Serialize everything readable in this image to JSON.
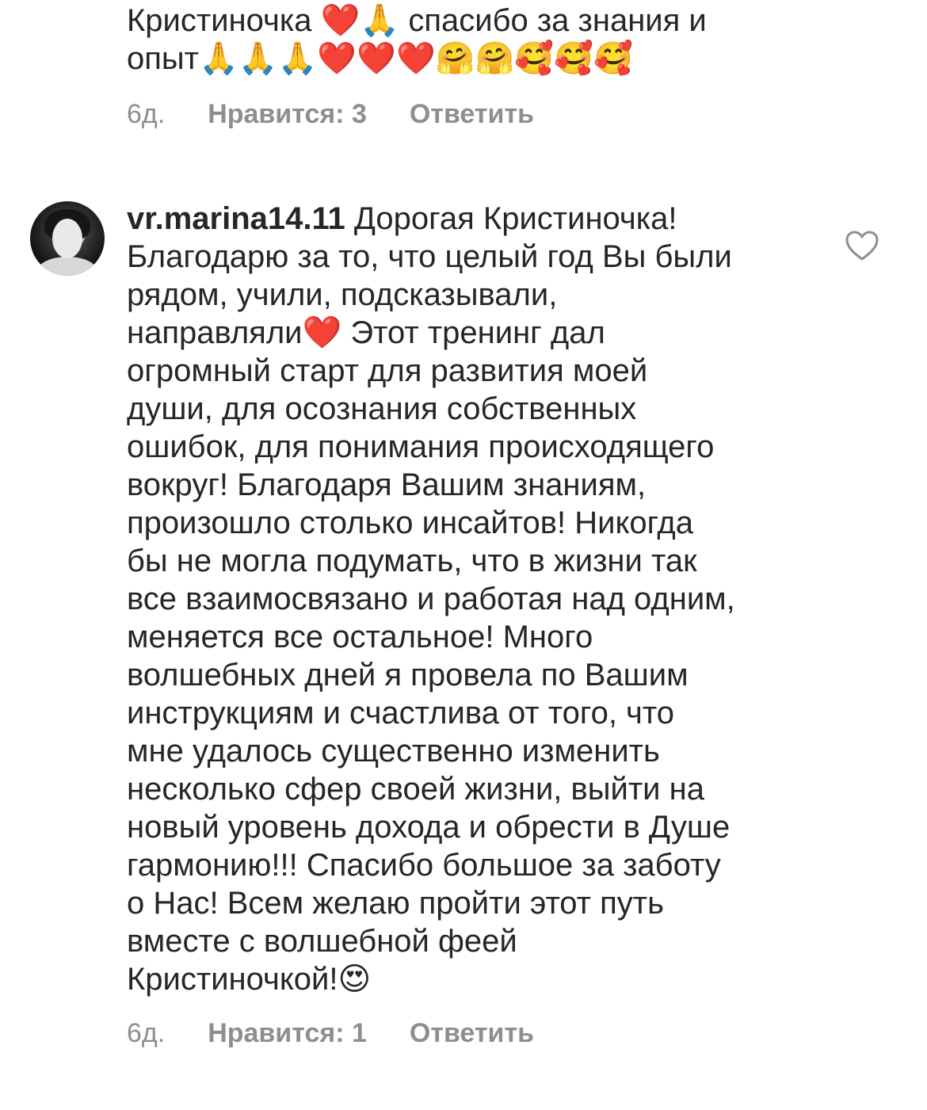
{
  "comments": [
    {
      "text": "Кристиночка ❤️🙏 спасибо за знания и\nопыт🙏🙏🙏❤️❤️❤️🤗🤗🥰🥰🥰",
      "time": "6д.",
      "likes": "Нравится: 3",
      "reply": "Ответить"
    },
    {
      "username": "vr.marina14.11",
      "text": " Дорогая Кристиночка!\nБлагодарю за то, что целый год Вы были\nрядом, учили, подсказывали,\nнаправляли❤️ Этот тренинг дал\nогромный старт для развития моей\nдуши, для осознания собственных\nошибок, для понимания происходящего\nвокруг! Благодаря Вашим знаниям,\nпроизошло столько инсайтов! Никогда\nбы не могла подумать, что в жизни так\nвсе взаимосвязано и работая над одним,\nменяется все остальное! Много\nволшебных дней я провела по Вашим\nинструкциям и счастлива от того, что\nмне удалось  существенно изменить\nнесколько сфер своей жизни, выйти на\nновый уровень дохода и обрести в Душе\nгармонию!!! Спасибо большое за заботу\nо Нас! Всем желаю пройти этот путь\nвместе с волшебной феей\nКристиночкой!😍",
      "time": "6д.",
      "likes": "Нравится: 1",
      "reply": "Ответить",
      "like_icon": "heart-outline-icon"
    }
  ],
  "colors": {
    "text": "#262626",
    "meta": "#8e8e8e",
    "background": "#ffffff"
  }
}
